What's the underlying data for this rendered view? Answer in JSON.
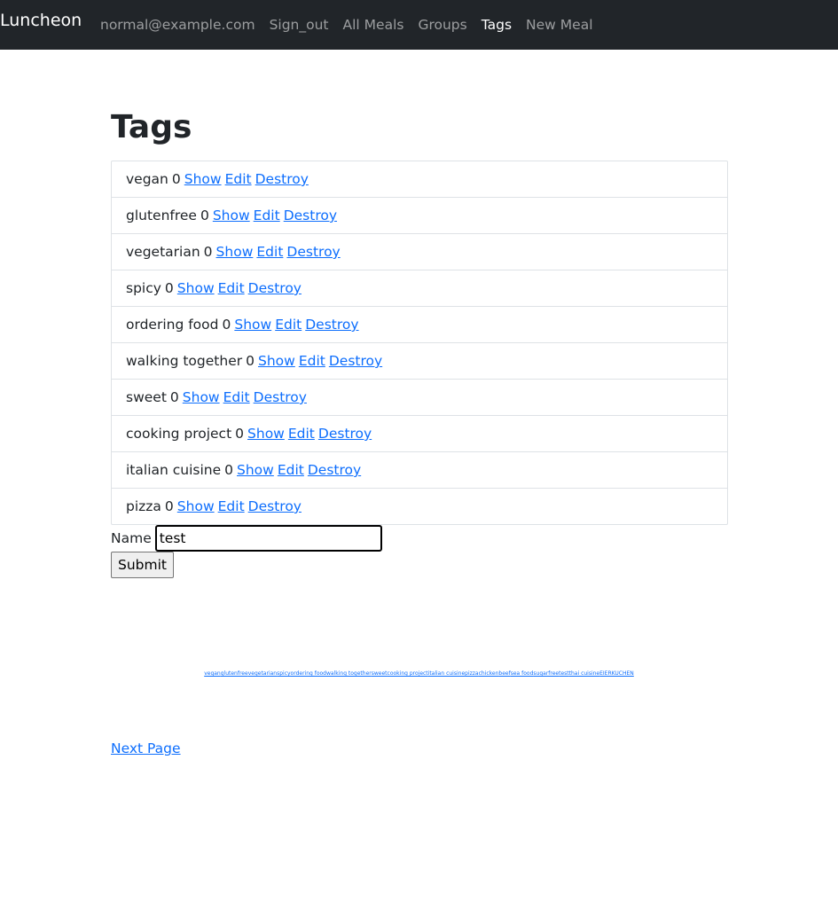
{
  "navbar": {
    "brand": "Luncheon",
    "links": [
      {
        "label": "normal@example.com",
        "active": false
      },
      {
        "label": "Sign_out",
        "active": false
      },
      {
        "label": "All Meals",
        "active": false
      },
      {
        "label": "Groups",
        "active": false
      },
      {
        "label": "Tags",
        "active": true
      },
      {
        "label": "New Meal",
        "active": false
      }
    ]
  },
  "page_title": "Tags",
  "tags": [
    {
      "name": "vegan",
      "count": "0"
    },
    {
      "name": "glutenfree",
      "count": "0"
    },
    {
      "name": "vegetarian",
      "count": "0"
    },
    {
      "name": "spicy",
      "count": "0"
    },
    {
      "name": "ordering food",
      "count": "0"
    },
    {
      "name": "walking together",
      "count": "0"
    },
    {
      "name": "sweet",
      "count": "0"
    },
    {
      "name": "cooking project",
      "count": "0"
    },
    {
      "name": "italian cuisine",
      "count": "0"
    },
    {
      "name": "pizza",
      "count": "0"
    }
  ],
  "actions": {
    "show": "Show",
    "edit": "Edit",
    "destroy": "Destroy"
  },
  "form": {
    "name_label": "Name",
    "name_value": "test",
    "submit_label": "Submit"
  },
  "tag_cloud": [
    "vegan",
    "glutenfree",
    "vegetarian",
    "spicy",
    "ordering food",
    "walking together",
    "sweet",
    "cooking project",
    "italian cuisine",
    "pizza",
    "chicken",
    "beef",
    "sea food",
    "sugarfree",
    "test",
    "thai cuisine",
    "EIERKUCHEN"
  ],
  "next_page": "Next Page",
  "colors": {
    "navbar_bg": "#212529",
    "link": "#0d6efd"
  }
}
